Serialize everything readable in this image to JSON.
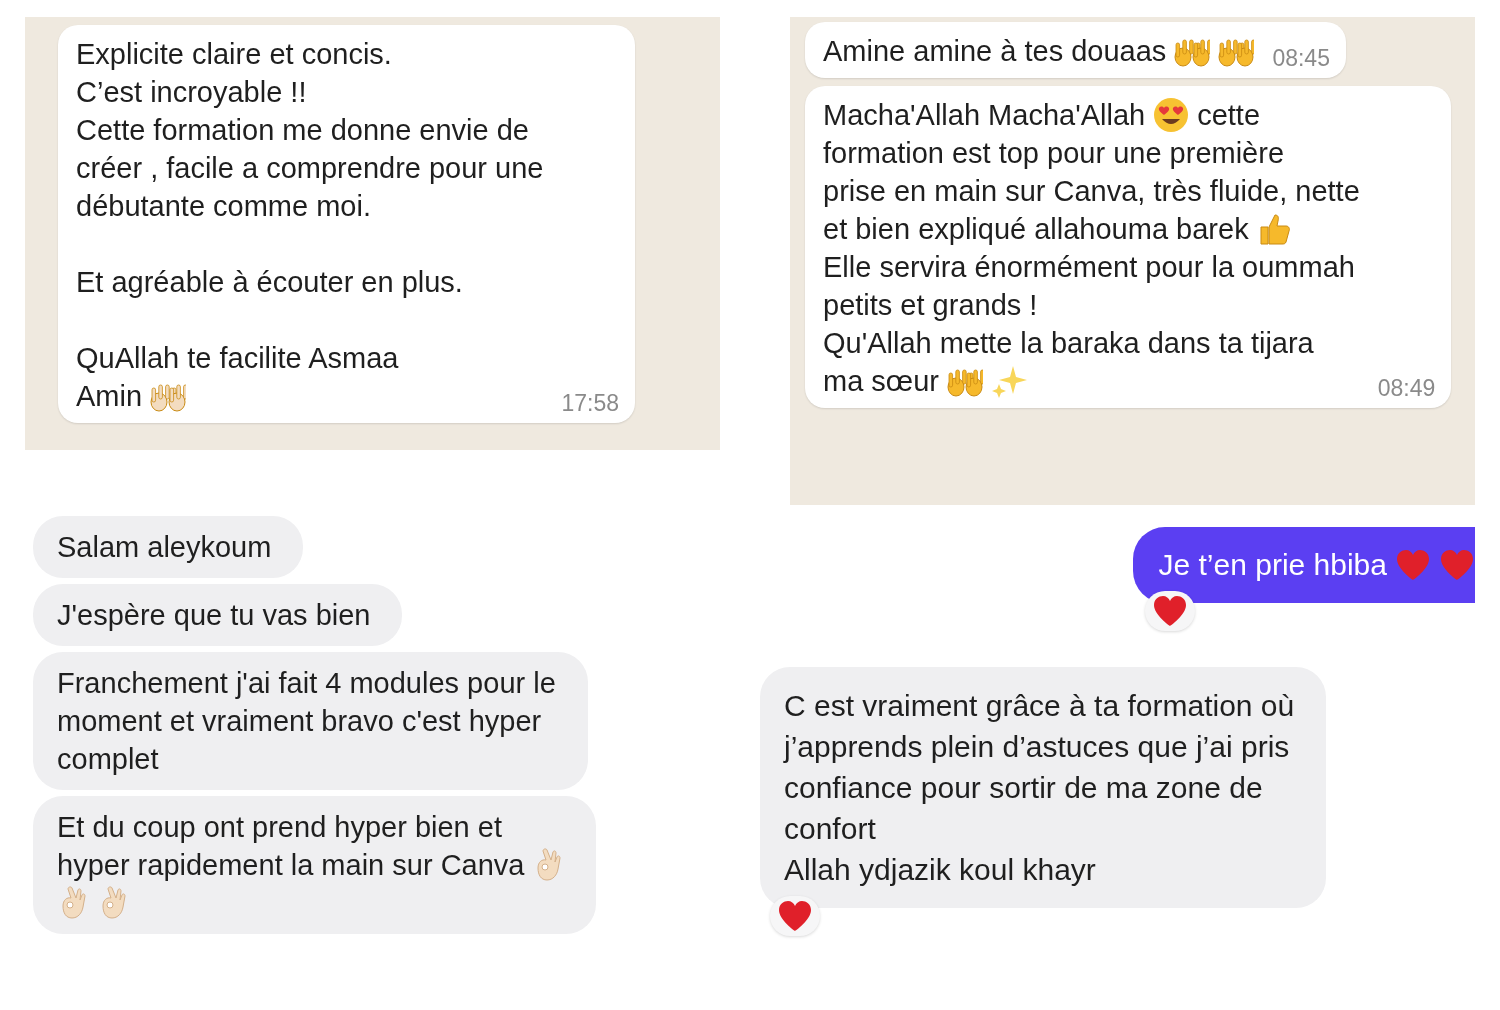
{
  "top_left": {
    "messages": [
      {
        "paragraphs": [
          [
            [
              {
                "kind": "text",
                "text": "Explicite claire et concis."
              }
            ],
            [
              {
                "kind": "text",
                "text": "C’est incroyable !!"
              }
            ],
            [
              {
                "kind": "text",
                "text": "Cette formation me donne envie de"
              }
            ],
            [
              {
                "kind": "text",
                "text": "créer , facile a comprendre pour une"
              }
            ],
            [
              {
                "kind": "text",
                "text": "débutante comme moi."
              }
            ]
          ],
          [
            [
              {
                "kind": "text",
                "text": "Et agréable à écouter en plus."
              }
            ]
          ],
          [
            [
              {
                "kind": "text",
                "text": "QuAllah te facilite Asmaa"
              }
            ],
            [
              {
                "kind": "text",
                "text": "Amin"
              },
              {
                "kind": "palehands"
              }
            ]
          ]
        ],
        "time": "17:58"
      }
    ]
  },
  "top_right": {
    "messages": [
      {
        "paragraphs": [
          [
            [
              {
                "kind": "text",
                "text": "Amine amine à tes douaas"
              },
              {
                "kind": "hands"
              },
              {
                "kind": "hands"
              }
            ]
          ]
        ],
        "time": "08:45"
      },
      {
        "paragraphs": [
          [
            [
              {
                "kind": "text",
                "text": "Macha'Allah Macha'Allah"
              },
              {
                "kind": "hearteyes"
              },
              {
                "kind": "text",
                "text": "cette"
              }
            ],
            [
              {
                "kind": "text",
                "text": "formation est top pour une première"
              }
            ],
            [
              {
                "kind": "text",
                "text": "prise en main sur Canva, très fluide, nette"
              }
            ],
            [
              {
                "kind": "text",
                "text": "et bien expliqué allahouma barek"
              },
              {
                "kind": "thumbsup"
              }
            ],
            [
              {
                "kind": "text",
                "text": "Elle servira énormément pour la oummah"
              }
            ],
            [
              {
                "kind": "text",
                "text": "petits et grands !"
              }
            ],
            [
              {
                "kind": "text",
                "text": "Qu'Allah mette la baraka dans ta tijara"
              }
            ],
            [
              {
                "kind": "text",
                "text": "ma sœur"
              },
              {
                "kind": "hands"
              },
              {
                "kind": "sparkles"
              }
            ]
          ]
        ],
        "time": "08:49"
      }
    ]
  },
  "bottom_left": {
    "messages": [
      {
        "lines": [
          [
            {
              "kind": "text",
              "text": "Salam aleykoum"
            }
          ]
        ]
      },
      {
        "lines": [
          [
            {
              "kind": "text",
              "text": "J'espère que tu vas bien"
            }
          ]
        ]
      },
      {
        "lines": [
          [
            {
              "kind": "text",
              "text": "Franchement j'ai fait 4 modules pour le"
            }
          ],
          [
            {
              "kind": "text",
              "text": "moment et vraiment bravo c'est hyper"
            }
          ],
          [
            {
              "kind": "text",
              "text": "complet"
            }
          ]
        ]
      },
      {
        "lines": [
          [
            {
              "kind": "text",
              "text": "Et du coup ont prend hyper bien et"
            }
          ],
          [
            {
              "kind": "text",
              "text": "hyper rapidement la main sur Canva"
            },
            {
              "kind": "okhand"
            }
          ],
          [
            {
              "kind": "okhand"
            },
            {
              "kind": "okhand"
            }
          ]
        ]
      }
    ]
  },
  "bottom_right": {
    "messages": [
      {
        "outgoing": true,
        "lines": [
          [
            {
              "kind": "text",
              "text": "Je t’en prie hbiba"
            },
            {
              "kind": "heart"
            },
            {
              "kind": "heart"
            }
          ]
        ],
        "reaction": {
          "kind": "heart"
        }
      },
      {
        "outgoing": false,
        "lines": [
          [
            {
              "kind": "text",
              "text": "C est vraiment grâce à ta formation où"
            }
          ],
          [
            {
              "kind": "text",
              "text": "j’apprends plein d’astuces que j’ai pris"
            }
          ],
          [
            {
              "kind": "text",
              "text": "confiance pour sortir de ma zone de"
            }
          ],
          [
            {
              "kind": "text",
              "text": "confort"
            }
          ],
          [
            {
              "kind": "text",
              "text": "Allah ydjazik koul khayr"
            }
          ]
        ],
        "reaction": {
          "kind": "heart"
        }
      }
    ]
  }
}
